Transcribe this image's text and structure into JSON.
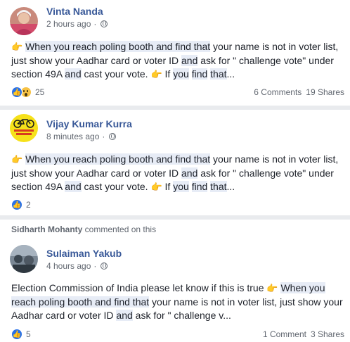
{
  "posts": [
    {
      "author": "Vinta Nanda",
      "time": "2 hours ago",
      "text": {
        "link1": "When you reach poling booth and find that",
        "plain1": " your name is not in voter list, just show your Aadhar card or voter ID ",
        "w_and1": "and",
        "plain2": " ask for \" challenge vote\" under section 49A ",
        "w_and2": "and",
        "plain3": " cast your vote. ",
        "plain4": " If ",
        "w_you": "you",
        "w_find": "find",
        "w_that": "that",
        "ellipsis": "..."
      },
      "reactions": {
        "count": "25",
        "icons": [
          "like-icon",
          "wow-icon"
        ]
      },
      "comments": "6 Comments",
      "shares": "19 Shares"
    },
    {
      "author": "Vijay Kumar Kurra",
      "time": "8 minutes ago",
      "text": {
        "link1": "When you reach poling booth and find that",
        "plain1": " your name is not in voter list, just show your Aadhar card or voter ID ",
        "w_and1": "and",
        "plain2": " ask for \" challenge vote\" under section 49A ",
        "w_and2": "and",
        "plain3": " cast your vote. ",
        "plain4": " If ",
        "w_you": "you",
        "w_find": "find",
        "w_that": "that",
        "ellipsis": "..."
      },
      "reactions": {
        "count": "2",
        "icons": [
          "like-icon"
        ]
      }
    },
    {
      "context_user": "Sidharth Mohanty",
      "context_text": " commented on this",
      "author": "Sulaiman Yakub",
      "time": "4 hours ago",
      "text": {
        "plain0": "Election Commission of India please let know if this is true ",
        "link1": "When you reach poling booth and find that",
        "plain1": " your name is not in voter list, just show your Aadhar card or voter ID ",
        "w_and1": "and",
        "plain2": " ask for \" challenge v",
        "ellipsis": "..."
      },
      "reactions": {
        "count": "5",
        "icons": [
          "like-icon"
        ]
      },
      "comments": "1 Comment",
      "shares": "3 Shares"
    }
  ],
  "colors": {
    "author_link": "#385898",
    "highlight": "#e7ecf6",
    "like_blue": "#2a72e8",
    "feed_bg": "#e9ebee"
  }
}
